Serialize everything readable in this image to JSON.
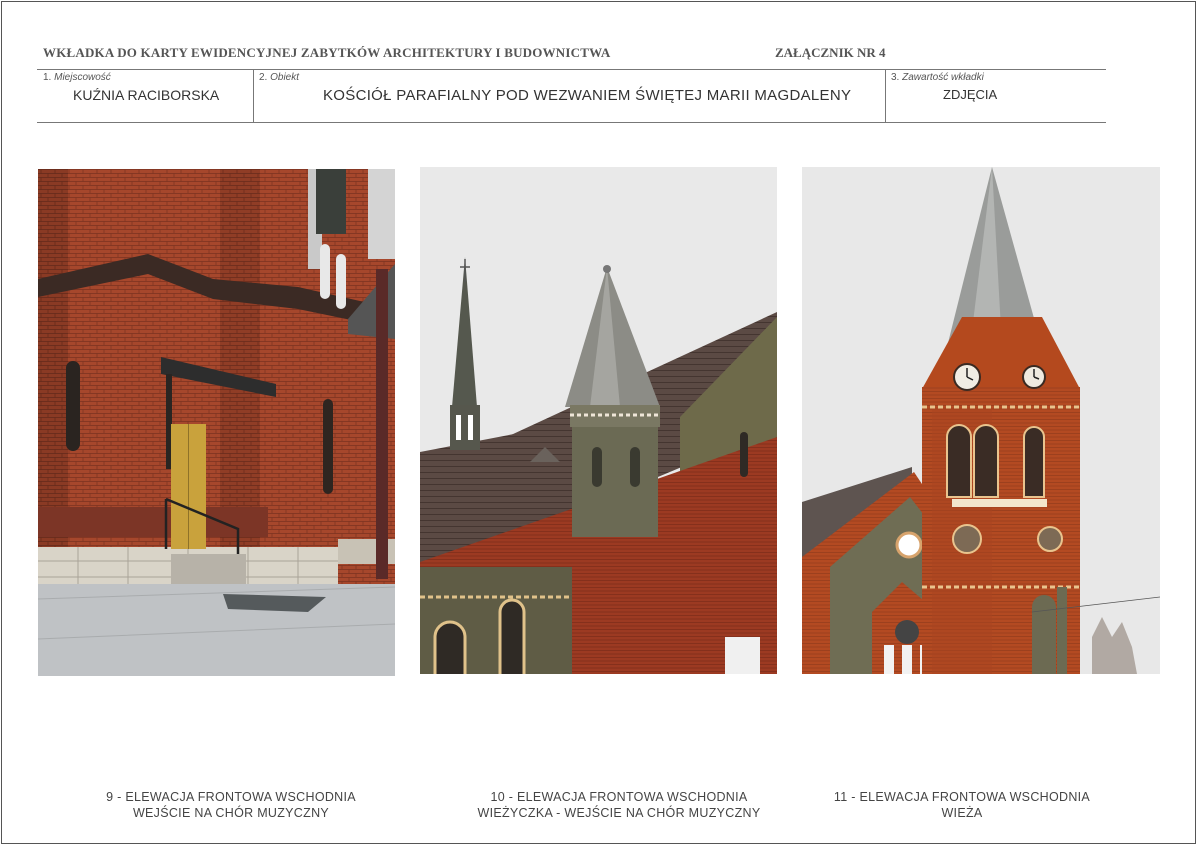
{
  "header": {
    "title": "WKŁADKA DO KARTY EWIDENCYJNEJ ZABYTKÓW ARCHITEKTURY I BUDOWNICTWA",
    "annex": "ZAŁĄCZNIK NR  4"
  },
  "form": {
    "field1": {
      "number": "1.",
      "label": "Miejscowość",
      "value": "KUŹNIA RACIBORSKA"
    },
    "field2": {
      "number": "2.",
      "label": "Obiekt",
      "value": "KOŚCIÓŁ PARAFIALNY POD WEZWANIEM ŚWIĘTEJ MARII MAGDALENY"
    },
    "field3": {
      "number": "3.",
      "label": "Zawartość wkładki",
      "value": "ZDJĘCIA"
    }
  },
  "photos": [
    {
      "caption_line1": "9 - ELEWACJA FRONTOWA WSCHODNIA",
      "caption_line2": "WEJŚCIE NA CHÓR MUZYCZNY"
    },
    {
      "caption_line1": "10 - ELEWACJA FRONTOWA WSCHODNIA",
      "caption_line2": "WIEŻYCZKA - WEJŚCIE NA CHÓR MUZYCZNY"
    },
    {
      "caption_line1": "11 - ELEWACJA FRONTOWA WSCHODNIA",
      "caption_line2": "WIEŻA"
    }
  ]
}
